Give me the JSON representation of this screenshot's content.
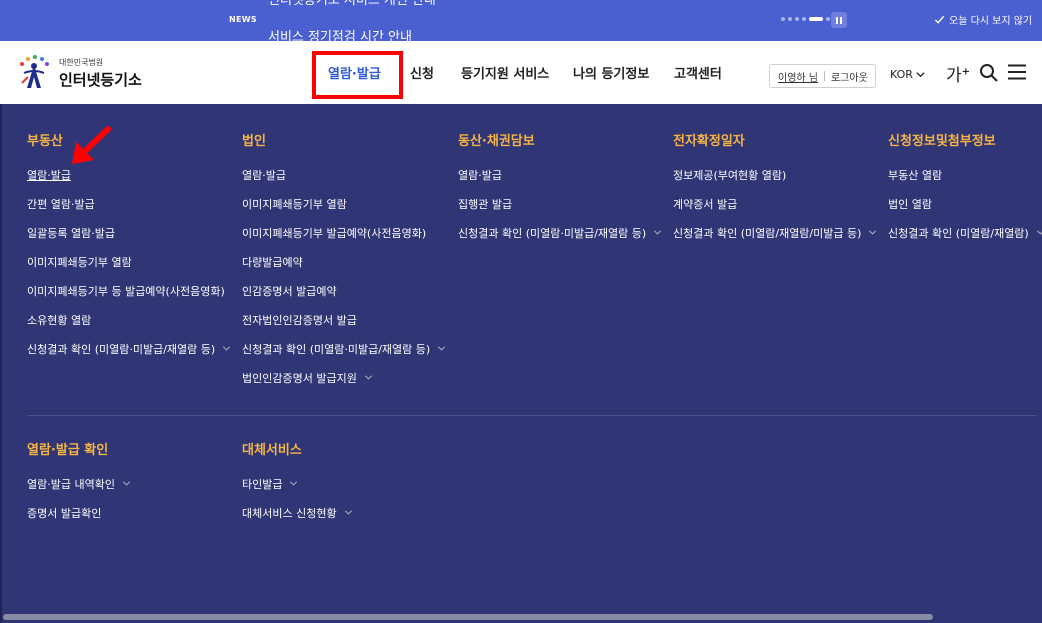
{
  "news_bar": {
    "tag": "NEWS",
    "headline_prev": "인터넷등기소 서비스 개선 안내",
    "headline": "서비스 정기점검 시간 안내",
    "dismiss_label": "오늘 다시 보지 않기"
  },
  "header": {
    "logo_sub": "대한민국법원",
    "logo_main": "인터넷등기소",
    "nav": [
      {
        "label": "열람·발급",
        "active": true
      },
      {
        "label": "신청"
      },
      {
        "label": "등기지원 서비스"
      },
      {
        "label": "나의 등기정보"
      },
      {
        "label": "고객센터"
      }
    ],
    "user_name": "이영하 님",
    "logout_label": "로그아웃",
    "lang": "KOR",
    "font_size_label": "가",
    "font_size_plus": "+"
  },
  "mega_menu": {
    "columns": [
      {
        "title": "부동산",
        "items": [
          {
            "label": "열람·발급"
          },
          {
            "label": "간편 열람·발급"
          },
          {
            "label": "일괄등록 열람·발급"
          },
          {
            "label": "이미지폐쇄등기부 열람"
          },
          {
            "label": "이미지폐쇄등기부 등 발급예약(사전음영화)"
          },
          {
            "label": "소유현황 열람"
          },
          {
            "label": "신청결과 확인 (미열람·미발급/재열람 등)"
          }
        ]
      },
      {
        "title": "법인",
        "items": [
          {
            "label": "열람·발급"
          },
          {
            "label": "이미지폐쇄등기부 열람"
          },
          {
            "label": "이미지폐쇄등기부 발급예약(사전음영화)"
          },
          {
            "label": "다량발급예약"
          },
          {
            "label": "인감증명서 발급예약"
          },
          {
            "label": "전자법인인감증명서 발급"
          },
          {
            "label": "신청결과 확인 (미열람·미발급/재열람 등)"
          },
          {
            "label": "법인인감증명서 발급지원"
          }
        ]
      },
      {
        "title": "동산·채권담보",
        "items": [
          {
            "label": "열람·발급"
          },
          {
            "label": "집행관 발급"
          },
          {
            "label": "신청결과 확인 (미열람·미발급/재열람 등)"
          }
        ]
      },
      {
        "title": "전자확정일자",
        "items": [
          {
            "label": "정보제공(부여현황 열람)"
          },
          {
            "label": "계약증서 발급"
          },
          {
            "label": "신청결과 확인 (미열람/재열람/미발급 등)"
          }
        ]
      },
      {
        "title": "신청정보및첨부정보",
        "items": [
          {
            "label": "부동산 열람"
          },
          {
            "label": "법인 열람"
          },
          {
            "label": "신청결과 확인 (미열람/재열람)"
          }
        ]
      },
      {
        "title": "열람·발급 확인",
        "items": [
          {
            "label": "열람·발급 내역확인"
          },
          {
            "label": "증명서 발급확인"
          }
        ]
      },
      {
        "title": "대체서비스",
        "items": [
          {
            "label": "타인발급"
          },
          {
            "label": "대체서비스 신청현황"
          }
        ]
      }
    ]
  },
  "colors": {
    "news_bg": "#4a5fd0",
    "menu_bg": "#2f3575",
    "section_title": "#f5b343",
    "nav_active": "#2f5bd8",
    "annotation_red": "#ff0000"
  },
  "icons": [
    "check-icon",
    "pause-icon",
    "chevron-down-icon",
    "search-icon",
    "hamburger-menu-icon",
    "court-emblem-icon",
    "red-arrow-annotation"
  ]
}
